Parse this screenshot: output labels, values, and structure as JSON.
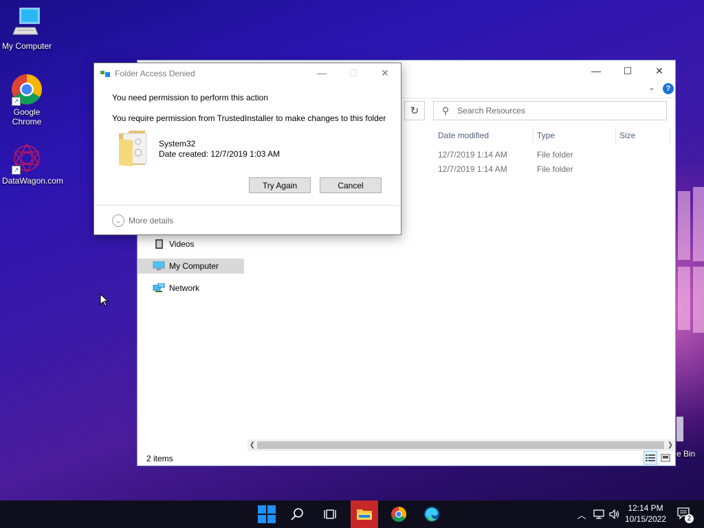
{
  "desktop": {
    "icons": [
      {
        "label": "My Computer"
      },
      {
        "label": "Google Chrome"
      },
      {
        "label": "DataWagon.com"
      }
    ],
    "recycle_partial": "e Bin"
  },
  "explorer": {
    "search_placeholder": "Search Resources",
    "columns": [
      "Date modified",
      "Type",
      "Size"
    ],
    "rows": [
      {
        "date": "12/7/2019 1:14 AM",
        "type": "File folder"
      },
      {
        "date": "12/7/2019 1:14 AM",
        "type": "File folder"
      }
    ],
    "nav": [
      {
        "label": "Videos"
      },
      {
        "label": "My Computer"
      },
      {
        "label": "Network"
      }
    ],
    "status": "2 items"
  },
  "dialog": {
    "title": "Folder Access Denied",
    "line1": "You need permission to perform this action",
    "line2": "You require permission from TrustedInstaller to make changes to this folder",
    "folder_name": "System32",
    "date_created": "Date created: 12/7/2019 1:03 AM",
    "try_again": "Try Again",
    "cancel": "Cancel",
    "more_details": "More details"
  },
  "taskbar": {
    "time": "12:14 PM",
    "date": "10/15/2022",
    "notification_count": "2"
  },
  "colors": {
    "taskbar": "#0e0e1c",
    "active_app": "#c62828",
    "selection": "#d9d9d9",
    "help": "#1e73d8"
  }
}
